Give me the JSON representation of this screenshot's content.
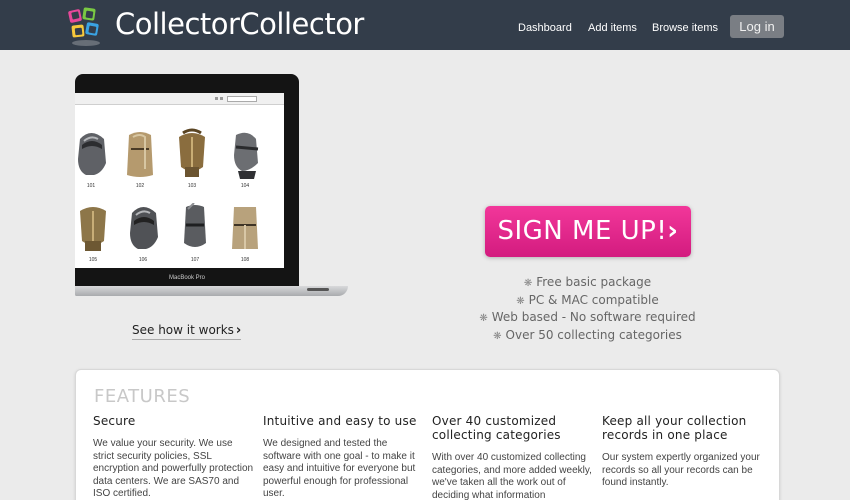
{
  "header": {
    "logo_text": "CollectorCollector",
    "nav": [
      "Dashboard",
      "Add items",
      "Browse items"
    ],
    "login_label": "Log in",
    "colors": {
      "background": "#333d4a",
      "login_button": "#7a7e84"
    }
  },
  "hero": {
    "screenshot_items": [
      "101",
      "102",
      "103",
      "104",
      "105",
      "106",
      "107",
      "108"
    ],
    "laptop_label": "MacBook Pro",
    "see_how_label": "See how it works",
    "signup_label": "SIGN ME UP!",
    "signup_color": "#e42a8d",
    "bullets": [
      "Free basic package",
      "PC & MAC compatible",
      "Web based - No software required",
      "Over 50 collecting categories"
    ]
  },
  "features": {
    "title": "FEATURES",
    "items": [
      {
        "heading": "Secure",
        "body": "We value your security. We use strict security policies, SSL encryption and powerfully protection data centers. We are SAS70 and ISO certified."
      },
      {
        "heading": "Intuitive and easy to use",
        "body": "We designed and tested the software with one goal - to make it easy and intuitive for everyone but powerful enough for professional user."
      },
      {
        "heading": "Over 40 customized collecting categories",
        "body": "With over 40 customized collecting categories, and more added weekly, we've taken all the work out of deciding what information"
      },
      {
        "heading": "Keep all your collection records in one place",
        "body": "Our system expertly organized your records so all your records can be found instantly."
      }
    ]
  }
}
